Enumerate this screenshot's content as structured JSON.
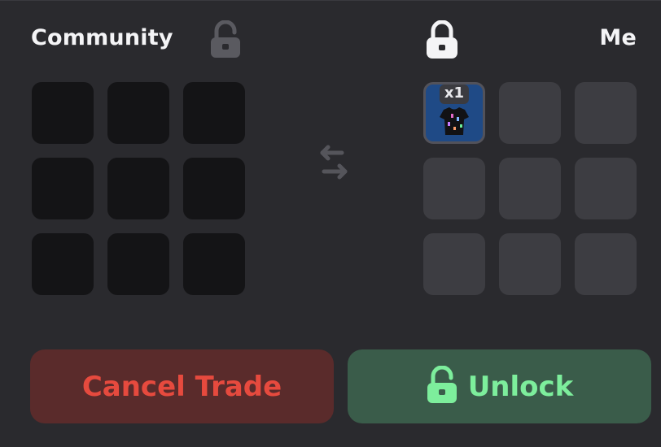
{
  "trade": {
    "left_title": "Community",
    "right_title": "Me",
    "left_lock_icon": "unlocked-padlock-icon",
    "right_lock_icon": "locked-padlock-icon",
    "swap_icon": "swap-arrows-icon",
    "left_slots": [
      {
        "state": "empty"
      },
      {
        "state": "empty"
      },
      {
        "state": "empty"
      },
      {
        "state": "empty"
      },
      {
        "state": "empty"
      },
      {
        "state": "empty"
      },
      {
        "state": "empty"
      },
      {
        "state": "empty"
      },
      {
        "state": "empty"
      }
    ],
    "right_slots": [
      {
        "state": "filled",
        "count_label": "x1",
        "icon": "shirt-item-icon"
      },
      {
        "state": "empty"
      },
      {
        "state": "empty"
      },
      {
        "state": "empty"
      },
      {
        "state": "empty"
      },
      {
        "state": "empty"
      },
      {
        "state": "empty"
      },
      {
        "state": "empty"
      },
      {
        "state": "empty"
      }
    ]
  },
  "buttons": {
    "cancel_label": "Cancel Trade",
    "unlock_label": "Unlock",
    "unlock_icon": "unlocked-padlock-icon"
  },
  "colors": {
    "background": "#2a2a2e",
    "cancel_bg": "#5a2b2b",
    "cancel_text": "#e64a3e",
    "unlock_bg": "#3a5c4a",
    "unlock_text": "#7dee9c",
    "item_bg": "#1f4a86"
  }
}
